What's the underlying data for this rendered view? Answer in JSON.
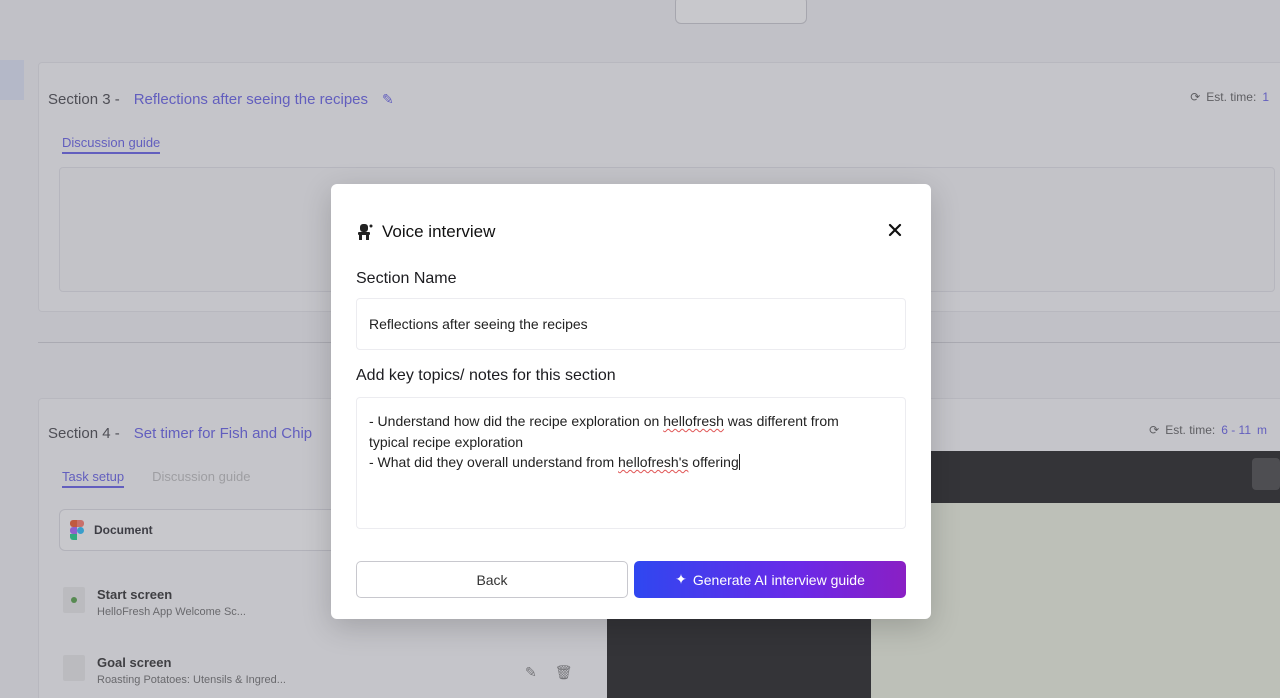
{
  "background": {
    "section3": {
      "label": "Section 3 -",
      "name": "Reflections after seeing the recipes",
      "est_label": "Est. time:",
      "est_value": "1",
      "tab_active": "Discussion guide"
    },
    "section4": {
      "label": "Section 4 -",
      "name": "Set timer for Fish and Chip",
      "est_label": "Est. time:",
      "est_value": "6 - 11",
      "est_unit": "m",
      "tab_active": "Task setup",
      "tab_inactive": "Discussion guide",
      "document_label": "Document",
      "screens": [
        {
          "title": "Start screen",
          "subtitle": "HelloFresh App Welcome Sc..."
        },
        {
          "title": "Goal screen",
          "subtitle": "Roasting Potatoes: Utensils & Ingred..."
        }
      ]
    }
  },
  "modal": {
    "title": "Voice interview",
    "section_name_label": "Section Name",
    "section_name_value": "Reflections after seeing the recipes",
    "notes_label": "Add key topics/ notes for this section",
    "notes_lines": {
      "l1a": "- Understand how did the recipe exploration on ",
      "l1b": "hellofresh",
      "l1c": " was different from",
      "l2": "typical recipe exploration",
      "l3a": "- What did they overall understand from ",
      "l3b": "hellofresh's",
      "l3c": " offering"
    },
    "back_label": "Back",
    "generate_label": "Generate AI interview guide"
  },
  "colors": {
    "accent": "#5b55e8",
    "gradient_start": "#2f47f0",
    "gradient_end": "#8a1fc4"
  },
  "icons": {
    "title_icon": "voice-interview-icon",
    "close": "close-icon",
    "generate": "sparkle-icon",
    "edit": "pencil-icon",
    "timer": "timer-icon"
  }
}
